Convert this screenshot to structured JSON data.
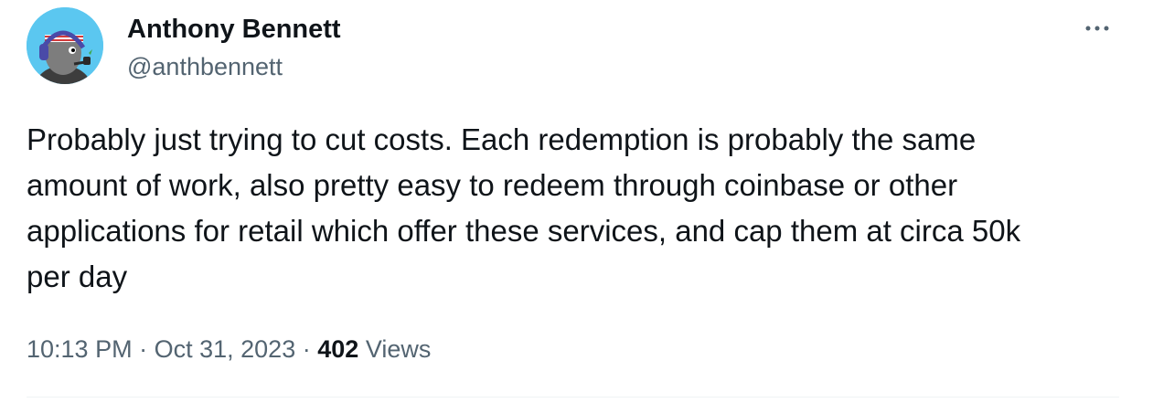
{
  "author": {
    "display_name": "Anthony Bennett",
    "handle": "@anthbennett",
    "avatar_icon": "cartoon-character-headphones-avatar"
  },
  "tweet": {
    "text": "Probably just trying to cut costs. Each redemption is probably the same\namount of work, also pretty easy to redeem through coinbase or other\napplications for retail which offer these services, and cap them at circa 50k\nper day"
  },
  "meta": {
    "time": "10:13 PM",
    "separator": "·",
    "date": "Oct 31, 2023",
    "views_count": "402",
    "views_label": "Views"
  },
  "icons": {
    "more": "more-horizontal-icon"
  },
  "colors": {
    "text_primary": "#0f1419",
    "text_secondary": "#536471",
    "avatar_background": "#5bc7f0",
    "divider": "#eff3f4"
  }
}
